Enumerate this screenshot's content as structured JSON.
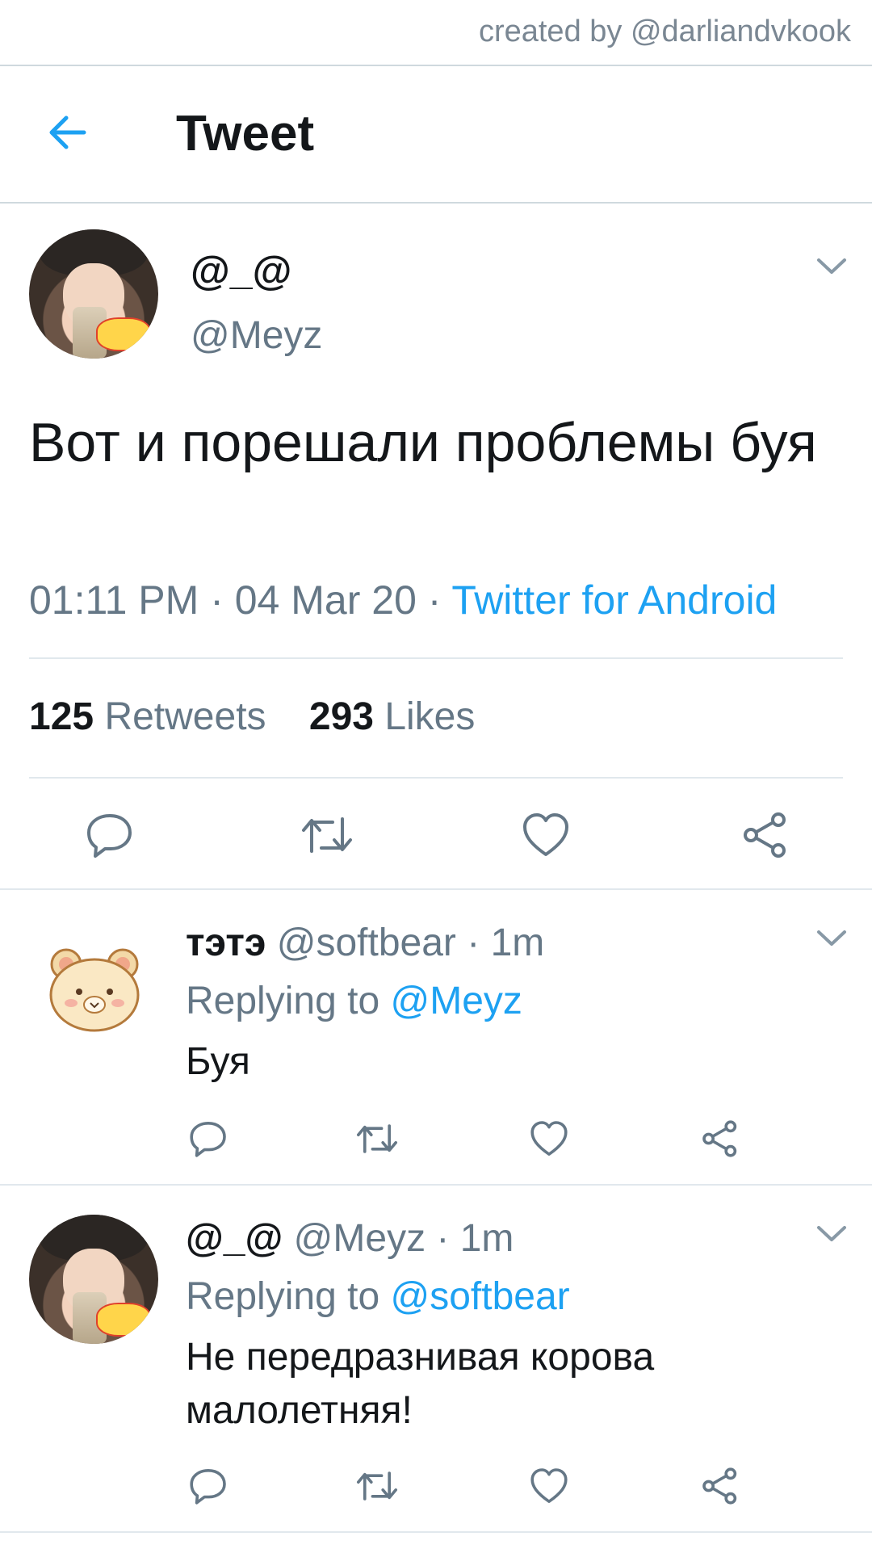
{
  "credit": "created by @darliandvkook",
  "header": {
    "title": "Tweet",
    "back_icon": "arrow-left-icon"
  },
  "tweet": {
    "display_name": "@_@",
    "handle": "@Meyz",
    "text": "Вот и порешали проблемы буя",
    "time": "01:11 PM",
    "date": "04 Mar 20",
    "dot1": " · ",
    "dot2": " · ",
    "source": "Twitter for Android",
    "retweets_count": "125",
    "retweets_label": "Retweets",
    "likes_count": "293",
    "likes_label": "Likes"
  },
  "replies": [
    {
      "display_name": "тэтэ",
      "handle": "@softbear",
      "dot": " · ",
      "time": "1m",
      "replying_prefix": "Replying to ",
      "replying_to": "@Meyz",
      "text": "Буя"
    },
    {
      "display_name": "@_@",
      "handle": "@Meyz",
      "dot": " · ",
      "time": "1m",
      "replying_prefix": "Replying to ",
      "replying_to": "@softbear",
      "text": "Не передразнивая корова малолетняя!"
    }
  ],
  "colors": {
    "accent": "#1da1f2",
    "secondary_text": "#657786",
    "primary_text": "#14171a",
    "divider": "#e1e8ed"
  },
  "icons": [
    "reply-icon",
    "retweet-icon",
    "like-icon",
    "share-icon",
    "chevron-down-icon"
  ]
}
